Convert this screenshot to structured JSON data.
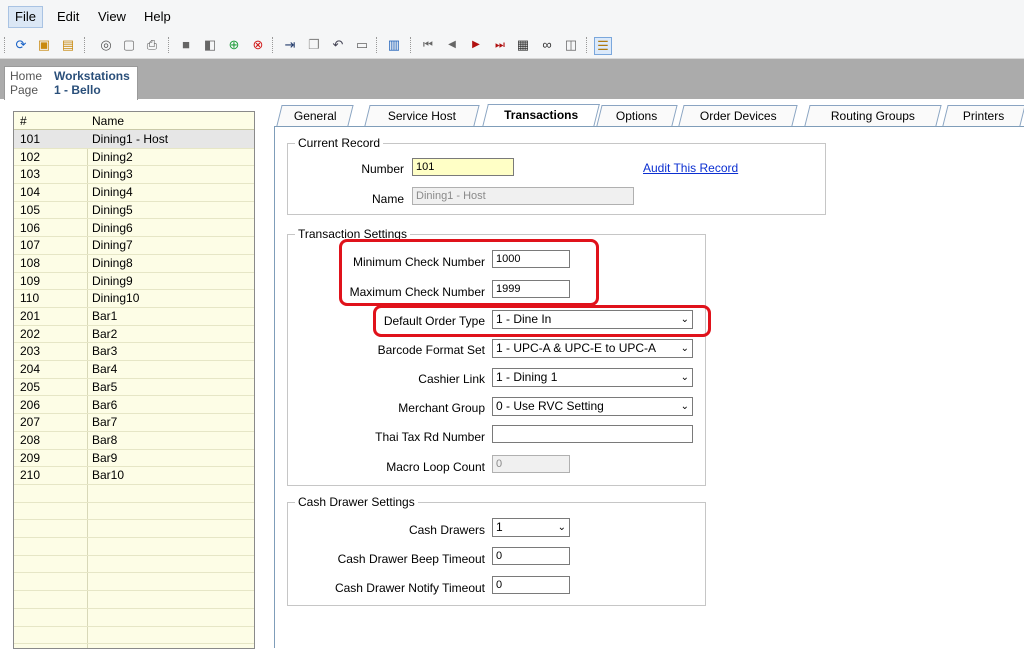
{
  "menu": [
    "File",
    "Edit",
    "View",
    "Help"
  ],
  "toolbar_icons": [
    "refresh-icon",
    "browse-icon",
    "browse-all-icon",
    "circle-icon",
    "document-icon",
    "print-icon",
    "save-icon",
    "save-all-icon",
    "add-icon",
    "delete-icon",
    "move-icon",
    "copy-icon",
    "undo-icon",
    "paste-icon",
    "panel-icon",
    "first-icon",
    "prev-icon",
    "next-icon",
    "last-icon",
    "goto-icon",
    "binoculars-icon",
    "window-icon",
    "grid-view-icon"
  ],
  "doc_tab": {
    "home": "Home Page",
    "home_line1": "Home",
    "home_line2": "Page",
    "title_line1": "Workstations",
    "title_line2": "1 - Bello"
  },
  "list": {
    "headers": {
      "num": "#",
      "name": "Name"
    },
    "rows": [
      {
        "num": "101",
        "name": "Dining1 - Host"
      },
      {
        "num": "102",
        "name": "Dining2"
      },
      {
        "num": "103",
        "name": "Dining3"
      },
      {
        "num": "104",
        "name": "Dining4"
      },
      {
        "num": "105",
        "name": "Dining5"
      },
      {
        "num": "106",
        "name": "Dining6"
      },
      {
        "num": "107",
        "name": "Dining7"
      },
      {
        "num": "108",
        "name": "Dining8"
      },
      {
        "num": "109",
        "name": "Dining9"
      },
      {
        "num": "110",
        "name": "Dining10"
      },
      {
        "num": "201",
        "name": "Bar1"
      },
      {
        "num": "202",
        "name": "Bar2"
      },
      {
        "num": "203",
        "name": "Bar3"
      },
      {
        "num": "204",
        "name": "Bar4"
      },
      {
        "num": "205",
        "name": "Bar5"
      },
      {
        "num": "206",
        "name": "Bar6"
      },
      {
        "num": "207",
        "name": "Bar7"
      },
      {
        "num": "208",
        "name": "Bar8"
      },
      {
        "num": "209",
        "name": "Bar9"
      },
      {
        "num": "210",
        "name": "Bar10"
      }
    ]
  },
  "tabs": [
    "General",
    "Service Host",
    "Transactions",
    "Options",
    "Order Devices",
    "Routing Groups",
    "Printers"
  ],
  "active_tab": "Transactions",
  "current_record": {
    "title": "Current Record",
    "number_label": "Number",
    "number_value": "101",
    "name_label": "Name",
    "name_value": "Dining1 - Host",
    "audit_link": "Audit This Record"
  },
  "transaction_settings": {
    "title": "Transaction Settings",
    "min_check_label": "Minimum Check Number",
    "min_check_value": "1000",
    "max_check_label": "Maximum Check Number",
    "max_check_value": "1999",
    "order_type_label": "Default Order Type",
    "order_type_value": "1 - Dine In",
    "barcode_label": "Barcode Format Set",
    "barcode_value": "1 - UPC-A & UPC-E to UPC-A",
    "cashier_label": "Cashier Link",
    "cashier_value": "1 - Dining 1",
    "merchant_label": "Merchant Group",
    "merchant_value": "0 - Use RVC Setting",
    "thai_label": "Thai Tax Rd Number",
    "thai_value": "",
    "macro_label": "Macro Loop Count",
    "macro_value": "0"
  },
  "cash_drawer": {
    "title": "Cash Drawer Settings",
    "drawers_label": "Cash Drawers",
    "drawers_value": "1",
    "beep_label": "Cash Drawer Beep Timeout",
    "beep_value": "0",
    "notify_label": "Cash Drawer Notify Timeout",
    "notify_value": "0"
  },
  "colors": {
    "highlight": "#e0121b",
    "list_bg": "#fdfde6",
    "field_yellow": "#ffffc6",
    "link": "#0b2fd1"
  }
}
